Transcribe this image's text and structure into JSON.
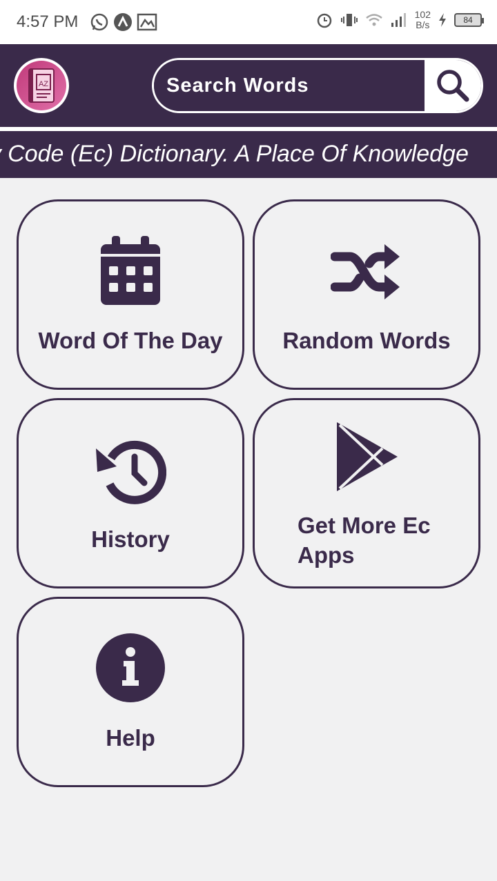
{
  "status_bar": {
    "time": "4:57 PM",
    "net_speed_value": "102",
    "net_speed_unit": "B/s",
    "battery": "84"
  },
  "header": {
    "logo_text": "AZ",
    "search": {
      "placeholder": "Search Words",
      "value": ""
    }
  },
  "marquee": {
    "text": "Everyday Code (Ec) Dictionary. A Place Of Knowledge"
  },
  "tiles": [
    {
      "label": "Word Of The Day",
      "icon": "calendar-icon"
    },
    {
      "label": "Random Words",
      "icon": "shuffle-icon"
    },
    {
      "label": "History",
      "icon": "history-icon"
    },
    {
      "label": "Get More Ec Apps",
      "icon": "play-store-icon"
    },
    {
      "label": "Help",
      "icon": "info-icon"
    }
  ],
  "colors": {
    "primary": "#3a2a4a",
    "background": "#f1f1f2",
    "logo_accent": "#c03a7a"
  }
}
